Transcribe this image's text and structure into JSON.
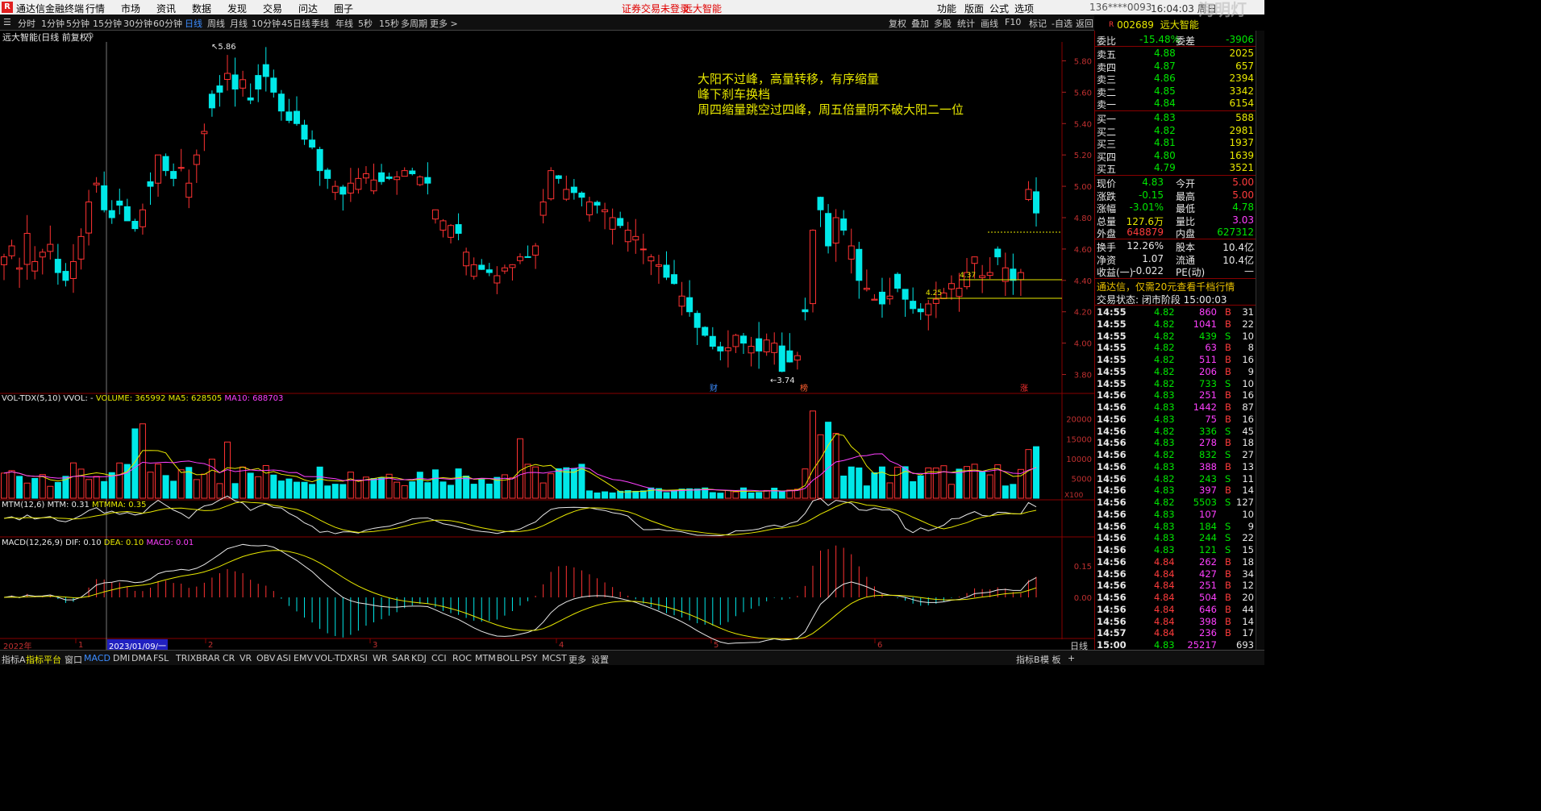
{
  "app": {
    "title": "通达信金融终端",
    "notice": "证券交易未登录",
    "notice_stock": "远大智能",
    "account": "136****0093",
    "time": "16:04:03 周日",
    "watermark": "海明灯",
    "menu": [
      "行情",
      "市场",
      "资讯",
      "数据",
      "发现",
      "交易",
      "问达",
      "圈子"
    ],
    "right_menu": [
      "功能",
      "版面",
      "公式",
      "选项"
    ]
  },
  "period_tabs": [
    "分时",
    "1分钟",
    "5分钟",
    "15分钟",
    "30分钟",
    "60分钟",
    "日线",
    "周线",
    "月线",
    "10分钟",
    "45日线",
    "季线",
    "年线",
    "5秒",
    "15秒",
    "多周期",
    "更多 >"
  ],
  "period_selected": "日线",
  "right_tools": [
    "复权",
    "叠加",
    "多股",
    "统计",
    "画线",
    "F10",
    "标记",
    "-自选",
    "返回"
  ],
  "chart_title": "远大智能(日线 前复权)",
  "annotation_lines": [
    "大阳不过峰，高量转移，有序缩量",
    "峰下刹车换档",
    "周四缩量跳空过四峰，周五倍量阴不破大阳二一位"
  ],
  "vol_title": {
    "name": "VOL-TDX(5,10)",
    "vvol": "VVOL: -",
    "volume": "VOLUME: 365992",
    "ma5": "MA5: 628505",
    "ma10": "MA10: 688703"
  },
  "mtm_title": {
    "name": "MTM(12,6)",
    "mtm": "MTM: 0.31",
    "mtmma": "MTMMA: 0.35"
  },
  "macd_title": {
    "name": "MACD(12,26,9)",
    "dif": "DIF: 0.10",
    "dea": "DEA: 0.10",
    "macd": "MACD: 0.01"
  },
  "price_labels": {
    "high": "5.86",
    "low": "3.74",
    "l1": "4.37",
    "l2": "4.25",
    "marker_cai": "财",
    "marker_bang": "榜",
    "marker_zhang": "涨"
  },
  "x_axis": {
    "year": "2022年",
    "date_cursor": "2023/01/09/一",
    "months": [
      "1",
      "2",
      "3",
      "4",
      "5",
      "6"
    ]
  },
  "vol_unit": "X100",
  "bottom_tabs": [
    "指标A",
    "指标平台",
    "窗口",
    "MACD",
    "DMI",
    "DMA",
    "FSL",
    "TRIX",
    "BRAR",
    "CR",
    "VR",
    "OBV",
    "ASI",
    "EMV",
    "VOL-TDX",
    "RSI",
    "WR",
    "SAR",
    "KDJ",
    "CCI",
    "ROC",
    "MTM",
    "BOLL",
    "PSY",
    "MCST",
    "更多",
    "设置"
  ],
  "bottom_right": [
    "指标B",
    "模 板",
    "+",
    "日线"
  ],
  "quote": {
    "code": "002689",
    "name": "远大智能",
    "weibi_label": "委比",
    "weibi": "-15.48%",
    "weicha_label": "委差",
    "weicha": "-3906",
    "asks": [
      [
        "卖五",
        "4.88",
        "2025"
      ],
      [
        "卖四",
        "4.87",
        "657"
      ],
      [
        "卖三",
        "4.86",
        "2394"
      ],
      [
        "卖二",
        "4.85",
        "3342"
      ],
      [
        "卖一",
        "4.84",
        "6154"
      ]
    ],
    "bids": [
      [
        "买一",
        "4.83",
        "588"
      ],
      [
        "买二",
        "4.82",
        "2981"
      ],
      [
        "买三",
        "4.81",
        "1937"
      ],
      [
        "买四",
        "4.80",
        "1639"
      ],
      [
        "买五",
        "4.79",
        "3521"
      ]
    ],
    "stats": [
      [
        "现价",
        "4.83",
        "今开",
        "5.00"
      ],
      [
        "涨跌",
        "-0.15",
        "最高",
        "5.00"
      ],
      [
        "涨幅",
        "-3.01%",
        "最低",
        "4.78"
      ],
      [
        "总量",
        "127.6万",
        "量比",
        "3.03"
      ],
      [
        "外盘",
        "648879",
        "内盘",
        "627312"
      ]
    ],
    "stats2": [
      [
        "换手",
        "12.26%",
        "股本",
        "10.4亿"
      ],
      [
        "净资",
        "1.07",
        "流通",
        "10.4亿"
      ],
      [
        "收益(一)",
        "-0.022",
        "PE(动)",
        "—"
      ]
    ],
    "ad": "通达信，仅需20元查看千档行情",
    "status": "交易状态: 闭市阶段 15:00:03"
  },
  "ticks": [
    [
      "14:55",
      "4.82",
      "860",
      "B",
      "31"
    ],
    [
      "14:55",
      "4.82",
      "1041",
      "B",
      "22"
    ],
    [
      "14:55",
      "4.82",
      "439",
      "S",
      "10"
    ],
    [
      "14:55",
      "4.82",
      "63",
      "B",
      "8"
    ],
    [
      "14:55",
      "4.82",
      "511",
      "B",
      "16"
    ],
    [
      "14:55",
      "4.82",
      "206",
      "B",
      "9"
    ],
    [
      "14:55",
      "4.82",
      "733",
      "S",
      "10"
    ],
    [
      "14:56",
      "4.83",
      "251",
      "B",
      "16"
    ],
    [
      "14:56",
      "4.83",
      "1442",
      "B",
      "87"
    ],
    [
      "14:56",
      "4.83",
      "75",
      "B",
      "16"
    ],
    [
      "14:56",
      "4.82",
      "336",
      "S",
      "45"
    ],
    [
      "14:56",
      "4.83",
      "278",
      "B",
      "18"
    ],
    [
      "14:56",
      "4.82",
      "832",
      "S",
      "27"
    ],
    [
      "14:56",
      "4.83",
      "388",
      "B",
      "13"
    ],
    [
      "14:56",
      "4.82",
      "243",
      "S",
      "11"
    ],
    [
      "14:56",
      "4.83",
      "397",
      "B",
      "14"
    ],
    [
      "14:56",
      "4.82",
      "5503",
      "S",
      "127"
    ],
    [
      "14:56",
      "4.83",
      "107",
      "",
      "10"
    ],
    [
      "14:56",
      "4.83",
      "184",
      "S",
      "9"
    ],
    [
      "14:56",
      "4.83",
      "244",
      "S",
      "22"
    ],
    [
      "14:56",
      "4.83",
      "121",
      "S",
      "15"
    ],
    [
      "14:56",
      "4.84",
      "262",
      "B",
      "18"
    ],
    [
      "14:56",
      "4.84",
      "427",
      "B",
      "34"
    ],
    [
      "14:56",
      "4.84",
      "251",
      "B",
      "12"
    ],
    [
      "14:56",
      "4.84",
      "504",
      "B",
      "20"
    ],
    [
      "14:56",
      "4.84",
      "646",
      "B",
      "44"
    ],
    [
      "14:56",
      "4.84",
      "398",
      "B",
      "14"
    ],
    [
      "14:57",
      "4.84",
      "236",
      "B",
      "17"
    ],
    [
      "15:00",
      "4.83",
      "25217",
      "",
      "693"
    ]
  ],
  "chart_data": {
    "type": "candlestick",
    "price_axis": [
      "5.80",
      "5.60",
      "5.40",
      "5.20",
      "5.00",
      "4.80",
      "4.60",
      "4.40",
      "4.20",
      "4.00",
      "3.80"
    ],
    "vol_axis": [
      "20000",
      "15000",
      "10000",
      "5000"
    ],
    "macd_axis": [
      "0.15",
      "0.00"
    ],
    "colors": {
      "up": "#ff3232",
      "down": "#00e8e8",
      "ma1": "#e8e8e8",
      "ma2": "#e8e800",
      "ma3": "#ff40ff"
    }
  }
}
